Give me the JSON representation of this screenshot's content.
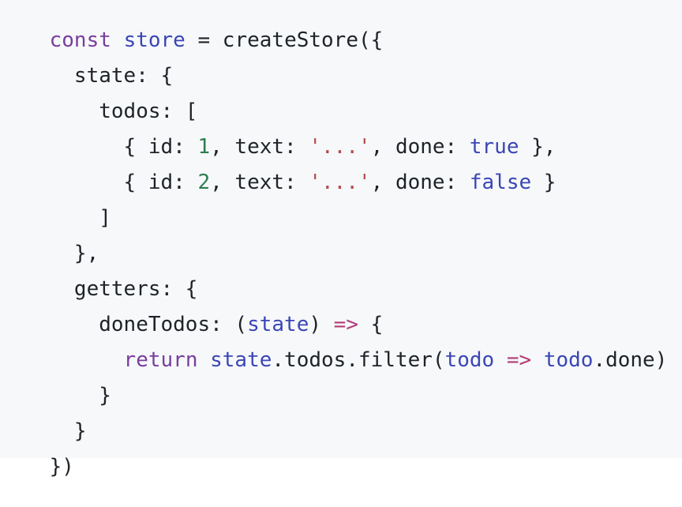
{
  "code": {
    "lines": [
      [
        {
          "t": "const",
          "k": "keyword"
        },
        {
          "t": " ",
          "k": "plain"
        },
        {
          "t": "store",
          "k": "var"
        },
        {
          "t": " = createStore({",
          "k": "plain"
        }
      ]
    ],
    "line_texts": [
      "const store = createStore({",
      "  state: {",
      "    todos: [",
      "      { id: 1, text: '...', done: true },",
      "      { id: 2, text: '...', done: false }",
      "    ]",
      "  },",
      "  getters: {",
      "    doneTodos: (state) => {",
      "      return state.todos.filter(todo => todo.done)",
      "    }",
      "  }",
      "})"
    ]
  },
  "colors": {
    "keyword": "#7a3e9d",
    "variable": "#3b46b5",
    "number": "#2e7d4f",
    "string": "#b44a4a",
    "boolean": "#3b46b5",
    "arrow": "#b43c78",
    "plain": "#1f2328",
    "background": "#f6f8fa"
  },
  "tokens": {
    "l1": {
      "a": "const",
      "b": " ",
      "c": "store",
      "d": " = createStore({"
    },
    "l2": {
      "a": "  state: {"
    },
    "l3": {
      "a": "    todos: ["
    },
    "l4": {
      "a": "      { id: ",
      "b": "1",
      "c": ", text: ",
      "d": "'...'",
      "e": ", done: ",
      "f": "true",
      "g": " },"
    },
    "l5": {
      "a": "      { id: ",
      "b": "2",
      "c": ", text: ",
      "d": "'...'",
      "e": ", done: ",
      "f": "false",
      "g": " }"
    },
    "l6": {
      "a": "    ]"
    },
    "l7": {
      "a": "  },"
    },
    "l8": {
      "a": "  getters: {"
    },
    "l9": {
      "a": "    doneTodos: (",
      "b": "state",
      "c": ") ",
      "d": "=>",
      "e": " {"
    },
    "l10": {
      "a": "      ",
      "b": "return",
      "c": " ",
      "d": "state",
      "e": ".todos.filter(",
      "f": "todo",
      "g": " ",
      "h": "=>",
      "i": " ",
      "j": "todo",
      "k": ".done)"
    },
    "l11": {
      "a": "    }"
    },
    "l12": {
      "a": "  }"
    },
    "l13": {
      "a": "})"
    }
  }
}
